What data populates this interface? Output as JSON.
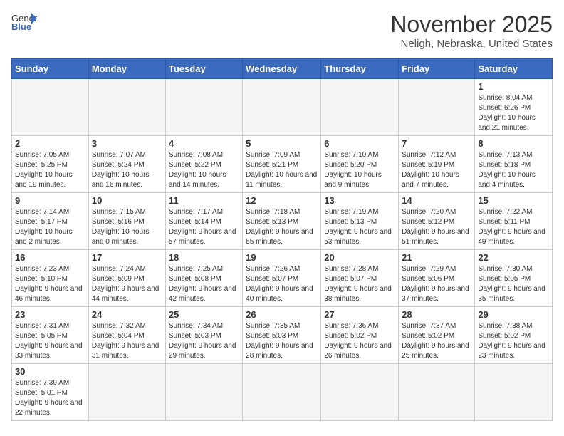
{
  "header": {
    "logo_general": "General",
    "logo_blue": "Blue",
    "month_year": "November 2025",
    "location": "Neligh, Nebraska, United States"
  },
  "days_of_week": [
    "Sunday",
    "Monday",
    "Tuesday",
    "Wednesday",
    "Thursday",
    "Friday",
    "Saturday"
  ],
  "weeks": [
    [
      {
        "day": "",
        "info": ""
      },
      {
        "day": "",
        "info": ""
      },
      {
        "day": "",
        "info": ""
      },
      {
        "day": "",
        "info": ""
      },
      {
        "day": "",
        "info": ""
      },
      {
        "day": "",
        "info": ""
      },
      {
        "day": "1",
        "info": "Sunrise: 8:04 AM\nSunset: 6:26 PM\nDaylight: 10 hours and 21 minutes."
      }
    ],
    [
      {
        "day": "2",
        "info": "Sunrise: 7:05 AM\nSunset: 5:25 PM\nDaylight: 10 hours and 19 minutes."
      },
      {
        "day": "3",
        "info": "Sunrise: 7:07 AM\nSunset: 5:24 PM\nDaylight: 10 hours and 16 minutes."
      },
      {
        "day": "4",
        "info": "Sunrise: 7:08 AM\nSunset: 5:22 PM\nDaylight: 10 hours and 14 minutes."
      },
      {
        "day": "5",
        "info": "Sunrise: 7:09 AM\nSunset: 5:21 PM\nDaylight: 10 hours and 11 minutes."
      },
      {
        "day": "6",
        "info": "Sunrise: 7:10 AM\nSunset: 5:20 PM\nDaylight: 10 hours and 9 minutes."
      },
      {
        "day": "7",
        "info": "Sunrise: 7:12 AM\nSunset: 5:19 PM\nDaylight: 10 hours and 7 minutes."
      },
      {
        "day": "8",
        "info": "Sunrise: 7:13 AM\nSunset: 5:18 PM\nDaylight: 10 hours and 4 minutes."
      }
    ],
    [
      {
        "day": "9",
        "info": "Sunrise: 7:14 AM\nSunset: 5:17 PM\nDaylight: 10 hours and 2 minutes."
      },
      {
        "day": "10",
        "info": "Sunrise: 7:15 AM\nSunset: 5:16 PM\nDaylight: 10 hours and 0 minutes."
      },
      {
        "day": "11",
        "info": "Sunrise: 7:17 AM\nSunset: 5:14 PM\nDaylight: 9 hours and 57 minutes."
      },
      {
        "day": "12",
        "info": "Sunrise: 7:18 AM\nSunset: 5:13 PM\nDaylight: 9 hours and 55 minutes."
      },
      {
        "day": "13",
        "info": "Sunrise: 7:19 AM\nSunset: 5:13 PM\nDaylight: 9 hours and 53 minutes."
      },
      {
        "day": "14",
        "info": "Sunrise: 7:20 AM\nSunset: 5:12 PM\nDaylight: 9 hours and 51 minutes."
      },
      {
        "day": "15",
        "info": "Sunrise: 7:22 AM\nSunset: 5:11 PM\nDaylight: 9 hours and 49 minutes."
      }
    ],
    [
      {
        "day": "16",
        "info": "Sunrise: 7:23 AM\nSunset: 5:10 PM\nDaylight: 9 hours and 46 minutes."
      },
      {
        "day": "17",
        "info": "Sunrise: 7:24 AM\nSunset: 5:09 PM\nDaylight: 9 hours and 44 minutes."
      },
      {
        "day": "18",
        "info": "Sunrise: 7:25 AM\nSunset: 5:08 PM\nDaylight: 9 hours and 42 minutes."
      },
      {
        "day": "19",
        "info": "Sunrise: 7:26 AM\nSunset: 5:07 PM\nDaylight: 9 hours and 40 minutes."
      },
      {
        "day": "20",
        "info": "Sunrise: 7:28 AM\nSunset: 5:07 PM\nDaylight: 9 hours and 38 minutes."
      },
      {
        "day": "21",
        "info": "Sunrise: 7:29 AM\nSunset: 5:06 PM\nDaylight: 9 hours and 37 minutes."
      },
      {
        "day": "22",
        "info": "Sunrise: 7:30 AM\nSunset: 5:05 PM\nDaylight: 9 hours and 35 minutes."
      }
    ],
    [
      {
        "day": "23",
        "info": "Sunrise: 7:31 AM\nSunset: 5:05 PM\nDaylight: 9 hours and 33 minutes."
      },
      {
        "day": "24",
        "info": "Sunrise: 7:32 AM\nSunset: 5:04 PM\nDaylight: 9 hours and 31 minutes."
      },
      {
        "day": "25",
        "info": "Sunrise: 7:34 AM\nSunset: 5:03 PM\nDaylight: 9 hours and 29 minutes."
      },
      {
        "day": "26",
        "info": "Sunrise: 7:35 AM\nSunset: 5:03 PM\nDaylight: 9 hours and 28 minutes."
      },
      {
        "day": "27",
        "info": "Sunrise: 7:36 AM\nSunset: 5:02 PM\nDaylight: 9 hours and 26 minutes."
      },
      {
        "day": "28",
        "info": "Sunrise: 7:37 AM\nSunset: 5:02 PM\nDaylight: 9 hours and 25 minutes."
      },
      {
        "day": "29",
        "info": "Sunrise: 7:38 AM\nSunset: 5:02 PM\nDaylight: 9 hours and 23 minutes."
      }
    ],
    [
      {
        "day": "30",
        "info": "Sunrise: 7:39 AM\nSunset: 5:01 PM\nDaylight: 9 hours and 22 minutes."
      },
      {
        "day": "",
        "info": ""
      },
      {
        "day": "",
        "info": ""
      },
      {
        "day": "",
        "info": ""
      },
      {
        "day": "",
        "info": ""
      },
      {
        "day": "",
        "info": ""
      },
      {
        "day": "",
        "info": ""
      }
    ]
  ]
}
